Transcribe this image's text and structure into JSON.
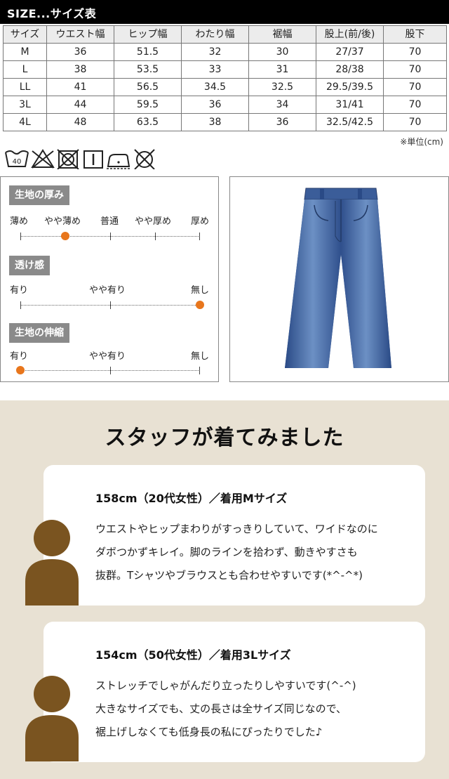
{
  "header": {
    "title": "SIZE...サイズ表"
  },
  "size_table": {
    "columns": [
      "サイズ",
      "ウエスト幅",
      "ヒップ幅",
      "わたり幅",
      "裾幅",
      "股上(前/後)",
      "股下"
    ],
    "rows": [
      [
        "M",
        "36",
        "51.5",
        "32",
        "30",
        "27/37",
        "70"
      ],
      [
        "L",
        "38",
        "53.5",
        "33",
        "31",
        "28/38",
        "70"
      ],
      [
        "LL",
        "41",
        "56.5",
        "34.5",
        "32.5",
        "29.5/39.5",
        "70"
      ],
      [
        "3L",
        "44",
        "59.5",
        "36",
        "34",
        "31/41",
        "70"
      ],
      [
        "4L",
        "48",
        "63.5",
        "38",
        "36",
        "32.5/42.5",
        "70"
      ]
    ],
    "unit_note": "※単位(cm)"
  },
  "care": {
    "wash_temp": "40",
    "icons": [
      "wash-40-icon",
      "no-bleach-icon",
      "no-tumble-dry-icon",
      "hang-dry-icon",
      "iron-low-with-cloth-icon",
      "no-dry-clean-icon"
    ]
  },
  "fabric": {
    "thickness": {
      "label": "生地の厚み",
      "options": [
        "薄め",
        "やや薄め",
        "普通",
        "やや厚め",
        "厚め"
      ],
      "selected_index": 1
    },
    "sheerness": {
      "label": "透け感",
      "options": [
        "有り",
        "やや有り",
        "無し"
      ],
      "selected_index": 2
    },
    "stretch": {
      "label": "生地の伸縮",
      "options": [
        "有り",
        "やや有り",
        "無し"
      ],
      "selected_index": 0
    },
    "accent_color": "#e8761c"
  },
  "staff": {
    "title": "スタッフが着てみました",
    "reviews": [
      {
        "header": "158cm（20代女性）／着用Mサイズ",
        "lines": [
          "ウエストやヒップまわりがすっきりしていて、ワイドなのに",
          "ダボつかずキレイ。脚のラインを拾わず、動きやすさも",
          "抜群。Tシャツやブラウスとも合わせやすいです(*^-^*)"
        ]
      },
      {
        "header": "154cm（50代女性）／着用3Lサイズ",
        "lines": [
          "ストレッチでしゃがんだり立ったりしやすいです(^-^)",
          "大きなサイズでも、丈の長さは全サイズ同じなので、",
          "裾上げしなくても低身長の私にぴったりでした♪"
        ]
      }
    ],
    "background_color": "#e8e1d3",
    "avatar_color": "#7a5420"
  }
}
